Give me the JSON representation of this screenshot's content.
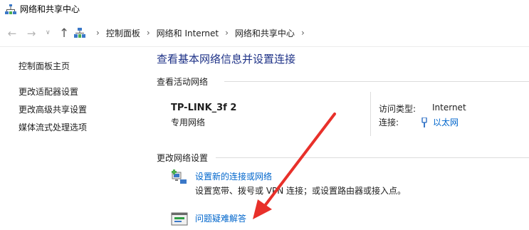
{
  "window": {
    "title": "网络和共享中心",
    "title_icon": "network-center-icon"
  },
  "navigation": {
    "back_icon": "back-arrow-icon",
    "forward_icon": "forward-arrow-icon",
    "recent_icon": "chevron-down-icon",
    "up_icon": "up-arrow-icon",
    "breadcrumb": [
      {
        "label": "控制面板"
      },
      {
        "label": "网络和 Internet"
      },
      {
        "label": "网络和共享中心"
      }
    ]
  },
  "sidebar": {
    "items": [
      {
        "label": "控制面板主页"
      },
      {
        "label": "更改适配器设置"
      },
      {
        "label": "更改高级共享设置"
      },
      {
        "label": "媒体流式处理选项"
      }
    ]
  },
  "main": {
    "title": "查看基本网络信息并设置连接",
    "active_networks": {
      "label": "查看活动网络",
      "network_name": "TP-LINK_3f 2",
      "network_type": "专用网络",
      "access_type_label": "访问类型:",
      "access_type_value": "Internet",
      "connection_label": "连接:",
      "connection_value": "以太网",
      "connection_icon": "ethernet-icon"
    },
    "change_settings": {
      "label": "更改网络设置",
      "tasks": [
        {
          "link": "设置新的连接或网络",
          "description": "设置宽带、拨号或 VPN 连接；或设置路由器或接入点。",
          "icon": "new-connection-icon"
        },
        {
          "link": "问题疑难解答",
          "description": "",
          "icon": "troubleshoot-icon"
        }
      ]
    }
  },
  "annotation": {
    "arrow_color": "#e8302a"
  },
  "colors": {
    "link": "#0066cc",
    "title": "#1e3287"
  }
}
